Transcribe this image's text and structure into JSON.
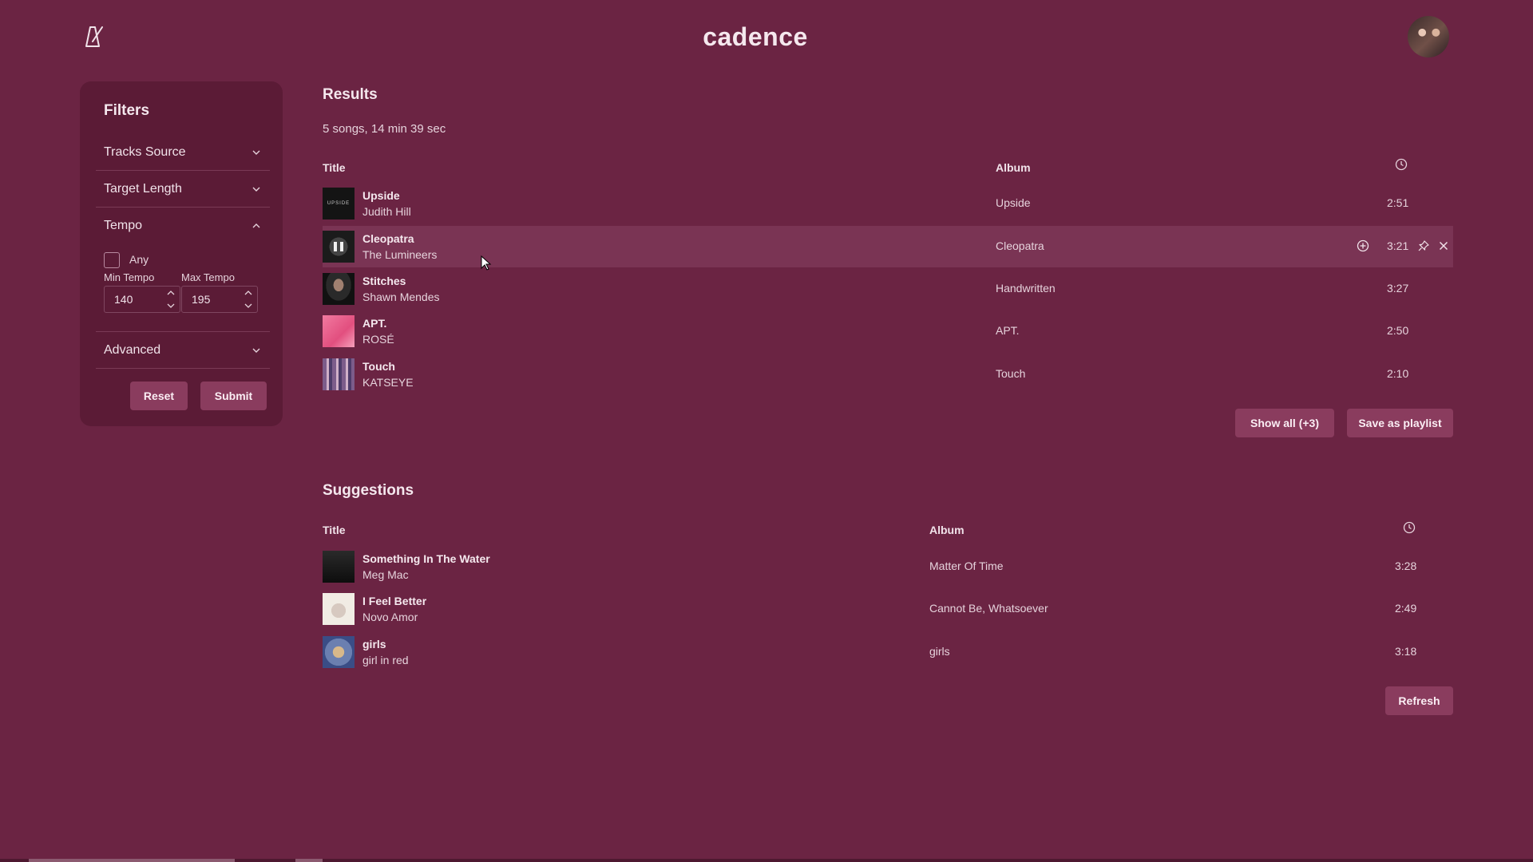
{
  "header": {
    "title": "cadence"
  },
  "filters": {
    "title": "Filters",
    "sections": [
      {
        "label": "Tracks Source",
        "expanded": false
      },
      {
        "label": "Target Length",
        "expanded": false
      },
      {
        "label": "Tempo",
        "expanded": true
      },
      {
        "label": "Advanced",
        "expanded": false
      }
    ],
    "tempo": {
      "any_label": "Any",
      "any_checked": false,
      "min_label": "Min Tempo",
      "max_label": "Max Tempo",
      "min_value": "140",
      "max_value": "195"
    },
    "reset_label": "Reset",
    "submit_label": "Submit"
  },
  "results": {
    "heading": "Results",
    "summary": "5 songs, 14 min 39 sec",
    "columns": {
      "title": "Title",
      "album": "Album"
    },
    "tracks": [
      {
        "title": "Upside",
        "artist": "Judith Hill",
        "album": "Upside",
        "duration": "2:51"
      },
      {
        "title": "Cleopatra",
        "artist": "The Lumineers",
        "album": "Cleopatra",
        "duration": "3:21",
        "playing": true
      },
      {
        "title": "Stitches",
        "artist": "Shawn Mendes",
        "album": "Handwritten",
        "duration": "3:27"
      },
      {
        "title": "APT.",
        "artist": "ROSÉ",
        "album": "APT.",
        "duration": "2:50"
      },
      {
        "title": "Touch",
        "artist": "KATSEYE",
        "album": "Touch",
        "duration": "2:10"
      }
    ],
    "show_all_label": "Show all (+3)",
    "save_label": "Save as playlist"
  },
  "suggestions": {
    "heading": "Suggestions",
    "columns": {
      "title": "Title",
      "album": "Album"
    },
    "tracks": [
      {
        "title": "Something In The Water",
        "artist": "Meg Mac",
        "album": "Matter Of Time",
        "duration": "3:28"
      },
      {
        "title": "I Feel Better",
        "artist": "Novo Amor",
        "album": "Cannot Be, Whatsoever",
        "duration": "2:49"
      },
      {
        "title": "girls",
        "artist": "girl in red",
        "album": "girls",
        "duration": "3:18"
      }
    ],
    "refresh_label": "Refresh"
  },
  "icons": {
    "logo": "metronome-icon",
    "chevron_down": "chevron-down-icon",
    "chevron_up": "chevron-up-icon",
    "clock": "clock-icon",
    "add": "add-circle-icon",
    "pin": "pin-icon",
    "remove": "close-icon",
    "pause": "pause-icon"
  },
  "colors": {
    "background": "#6b2443",
    "panel": "#5b1b36",
    "button": "#8a3c5e",
    "row_highlight": "#7a3454"
  }
}
